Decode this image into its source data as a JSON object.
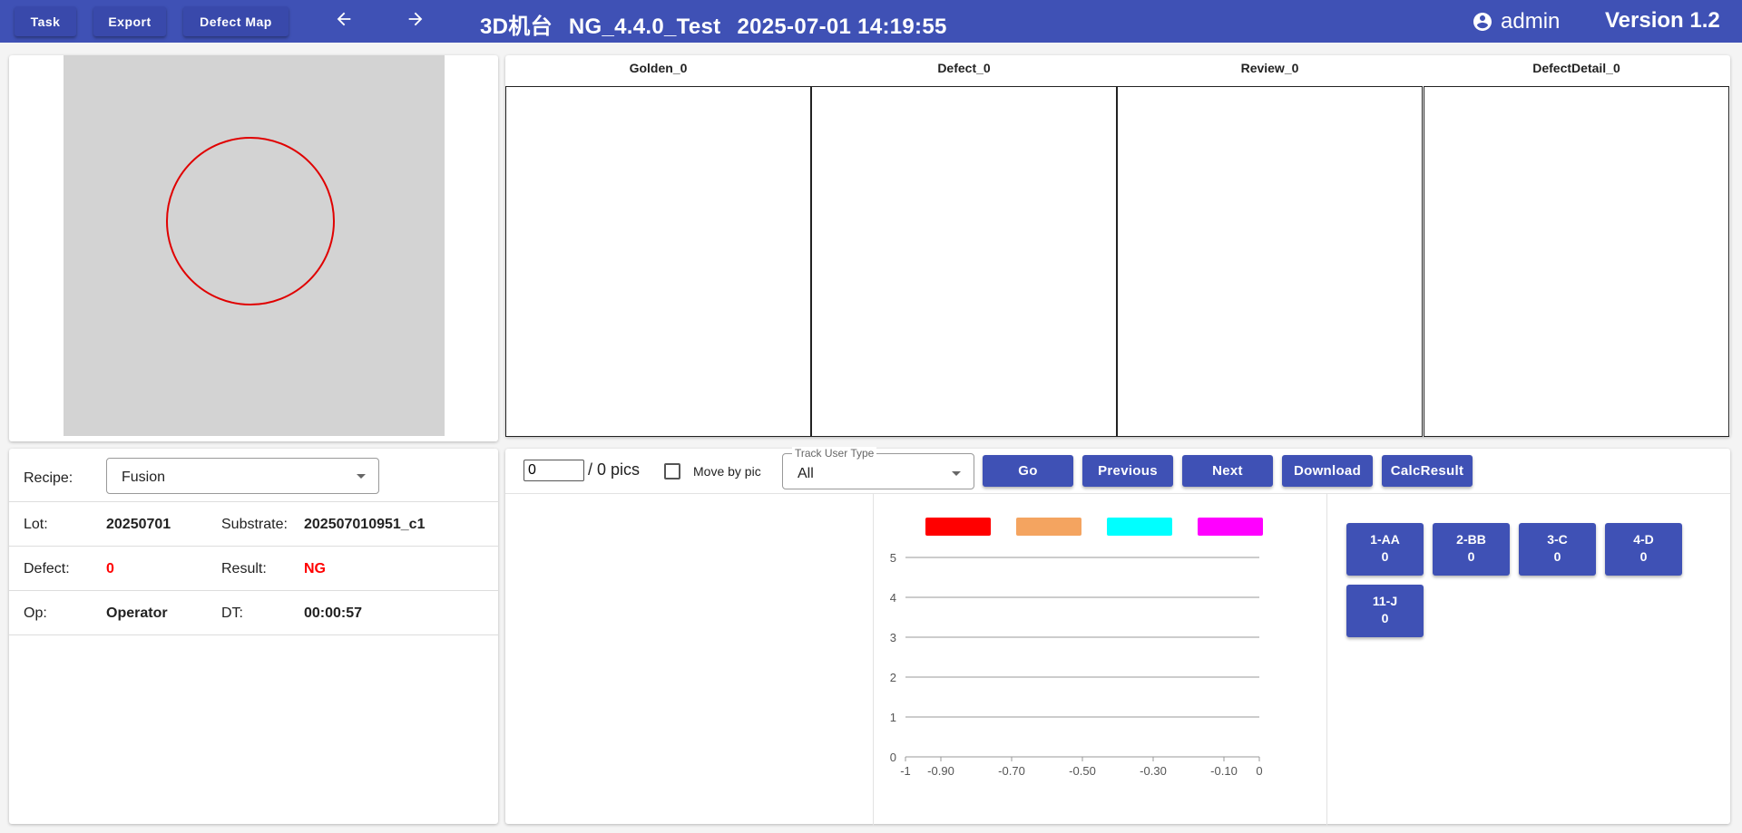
{
  "toolbar": {
    "task_label": "Task",
    "export_label": "Export",
    "defect_map_label": "Defect Map",
    "back_icon": "arrow-left-icon",
    "forward_icon": "arrow-right-icon",
    "machine": "3D机台",
    "recipe_name": "NG_4.4.0_Test",
    "datetime": "2025-07-01 14:19:55",
    "user": "admin",
    "version": "Version 1.2"
  },
  "colors": {
    "primary": "#3f51b5",
    "wafer_bg": "#d3d3d3",
    "wafer_outline": "#e00000",
    "ng": "#ff0000"
  },
  "images": [
    "Golden_0",
    "Defect_0",
    "Review_0",
    "DefectDetail_0"
  ],
  "info": {
    "recipe_label": "Recipe:",
    "recipe_value": "Fusion",
    "lot_label": "Lot:",
    "lot_value": "20250701",
    "substrate_label": "Substrate:",
    "substrate_value": "202507010951_c1",
    "defect_label": "Defect:",
    "defect_value": "0",
    "result_label": "Result:",
    "result_value": "NG",
    "op_label": "Op:",
    "op_value": "Operator",
    "dt_label": "DT:",
    "dt_value": "00:00:57"
  },
  "controls": {
    "pic_index": "0",
    "pic_count_text": "/ 0 pics",
    "move_by_pic_label": "Move by pic",
    "move_by_pic_checked": false,
    "track_user_type_label": "Track User Type",
    "track_user_type_value": "All",
    "go_label": "Go",
    "previous_label": "Previous",
    "next_label": "Next",
    "download_label": "Download",
    "calc_result_label": "CalcResult"
  },
  "chart_data": {
    "type": "bar",
    "legend": [
      {
        "name": "",
        "color": "#ff0000"
      },
      {
        "name": "",
        "color": "#f4a460"
      },
      {
        "name": "",
        "color": "#00ffff"
      },
      {
        "name": "",
        "color": "#ff00ff"
      }
    ],
    "x_ticks": [
      "-1",
      "-0.90",
      "-0.70",
      "-0.50",
      "-0.30",
      "-0.10",
      "0"
    ],
    "y_ticks": [
      "0",
      "1",
      "2",
      "3",
      "4",
      "5"
    ],
    "xlim": [
      -1,
      0
    ],
    "ylim": [
      0,
      5
    ],
    "grid": true,
    "series": []
  },
  "categories": [
    {
      "name": "1-AA",
      "count": "0"
    },
    {
      "name": "2-BB",
      "count": "0"
    },
    {
      "name": "3-C",
      "count": "0"
    },
    {
      "name": "4-D",
      "count": "0"
    },
    {
      "name": "11-J",
      "count": "0"
    }
  ]
}
